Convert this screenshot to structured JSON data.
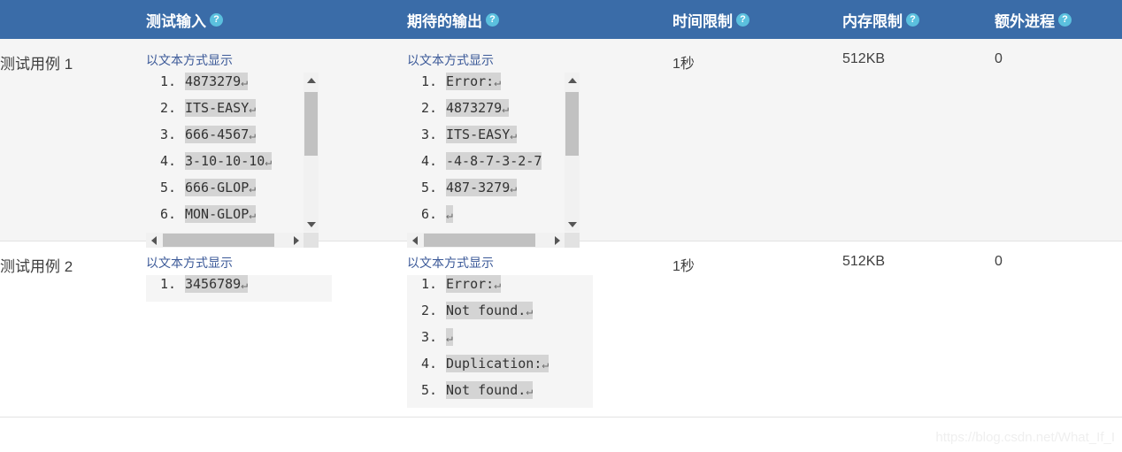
{
  "table": {
    "columns": [
      {
        "key": "case",
        "label": "",
        "help": false
      },
      {
        "key": "input",
        "label": "测试输入",
        "help": true,
        "help_glyph": "?"
      },
      {
        "key": "output",
        "label": "期待的输出",
        "help": true,
        "help_glyph": "?"
      },
      {
        "key": "time",
        "label": "时间限制",
        "help": true,
        "help_glyph": "?"
      },
      {
        "key": "memory",
        "label": "内存限制",
        "help": true,
        "help_glyph": "?"
      },
      {
        "key": "extra_proc",
        "label": "额外进程",
        "help": true,
        "help_glyph": "?"
      }
    ],
    "rows": [
      {
        "case_label": "测试用例 1",
        "input": {
          "link_label": "以文本方式显示",
          "lines": [
            {
              "no": "1.",
              "text": "4873279",
              "crlf": "↵"
            },
            {
              "no": "2.",
              "text": "ITS-EASY",
              "crlf": "↵"
            },
            {
              "no": "3.",
              "text": "666-4567",
              "crlf": "↵"
            },
            {
              "no": "4.",
              "text": "3-10-10-10",
              "crlf": "↵"
            },
            {
              "no": "5.",
              "text": "666-GLOP",
              "crlf": "↵"
            },
            {
              "no": "6.",
              "text": "MON-GLOP",
              "crlf": "↵"
            }
          ],
          "has_scrollbars": true
        },
        "output": {
          "link_label": "以文本方式显示",
          "lines": [
            {
              "no": "1.",
              "text": "Error:",
              "crlf": "↵"
            },
            {
              "no": "2.",
              "text": "4873279",
              "crlf": "↵"
            },
            {
              "no": "3.",
              "text": "ITS-EASY",
              "crlf": "↵"
            },
            {
              "no": "4.",
              "text": "-4-8-7-3-2-7",
              "crlf": ""
            },
            {
              "no": "5.",
              "text": "487-3279",
              "crlf": "↵"
            },
            {
              "no": "6.",
              "text": "",
              "crlf": "↵"
            }
          ],
          "has_scrollbars": true
        },
        "time": "1秒",
        "memory": "512KB",
        "extra_proc": "0"
      },
      {
        "case_label": "测试用例 2",
        "input": {
          "link_label": "以文本方式显示",
          "lines": [
            {
              "no": "1.",
              "text": "3456789",
              "crlf": "↵"
            }
          ],
          "has_scrollbars": false
        },
        "output": {
          "link_label": "以文本方式显示",
          "lines": [
            {
              "no": "1.",
              "text": "Error:",
              "crlf": "↵"
            },
            {
              "no": "2.",
              "text": "Not found.",
              "crlf": "↵"
            },
            {
              "no": "3.",
              "text": "",
              "crlf": "↵"
            },
            {
              "no": "4.",
              "text": "Duplication:",
              "crlf": "↵"
            },
            {
              "no": "5.",
              "text": "Not found.",
              "crlf": "↵"
            }
          ],
          "has_scrollbars": false
        },
        "time": "1秒",
        "memory": "512KB",
        "extra_proc": "0"
      }
    ]
  },
  "watermark": {
    "text": "https://blog.csdn.net/What_If_I"
  },
  "colors": {
    "header_bg": "#3a6ca8",
    "header_text": "#ffffff",
    "help_icon_bg": "#5bc0de",
    "row_bg": "#f5f5f5",
    "row_alt_bg": "#ffffff",
    "link": "#3b5998",
    "code_highlight": "#d4d4d4",
    "scrollbar_thumb": "#c1c1c1"
  }
}
